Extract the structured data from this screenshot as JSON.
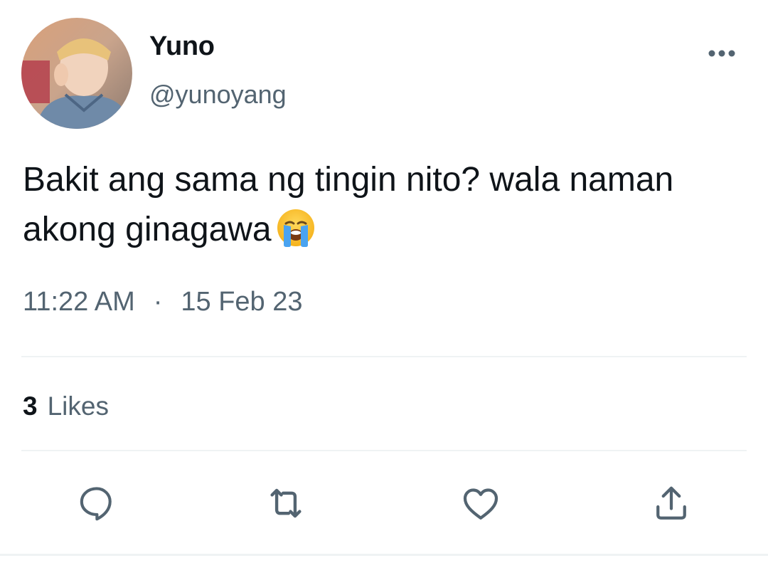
{
  "user": {
    "display_name": "Yuno",
    "handle": "@yunoyang"
  },
  "tweet": {
    "text": "Bakit ang sama ng tingin nito? wala naman\nakong ginagawa",
    "emoji": "loudly-crying-face",
    "time": "11:22 AM",
    "separator": "·",
    "date": "15 Feb 23"
  },
  "stats": {
    "likes_count": "3",
    "likes_label": "Likes"
  },
  "actions": [
    {
      "name": "reply",
      "icon": "reply-icon"
    },
    {
      "name": "retweet",
      "icon": "retweet-icon"
    },
    {
      "name": "like",
      "icon": "heart-icon"
    },
    {
      "name": "share",
      "icon": "share-icon"
    }
  ],
  "colors": {
    "text_primary": "#0f1419",
    "text_secondary": "#536471",
    "divider": "#eff3f4"
  }
}
